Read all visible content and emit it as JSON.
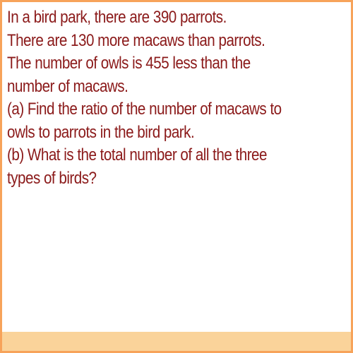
{
  "problem": {
    "lines": [
      "In a bird park, there are 390 parrots.",
      "There are 130 more macaws than parrots.",
      "The number of owls is 455 less than the",
      "number of macaws.",
      "(a) Find the ratio of the number of macaws to",
      "owls to parrots in the bird park.",
      "(b) What is the total number of all the three",
      "types of birds?"
    ]
  },
  "colors": {
    "text": "#8b1a1a",
    "border": "#f7a35a",
    "footer": "#fad39a"
  }
}
